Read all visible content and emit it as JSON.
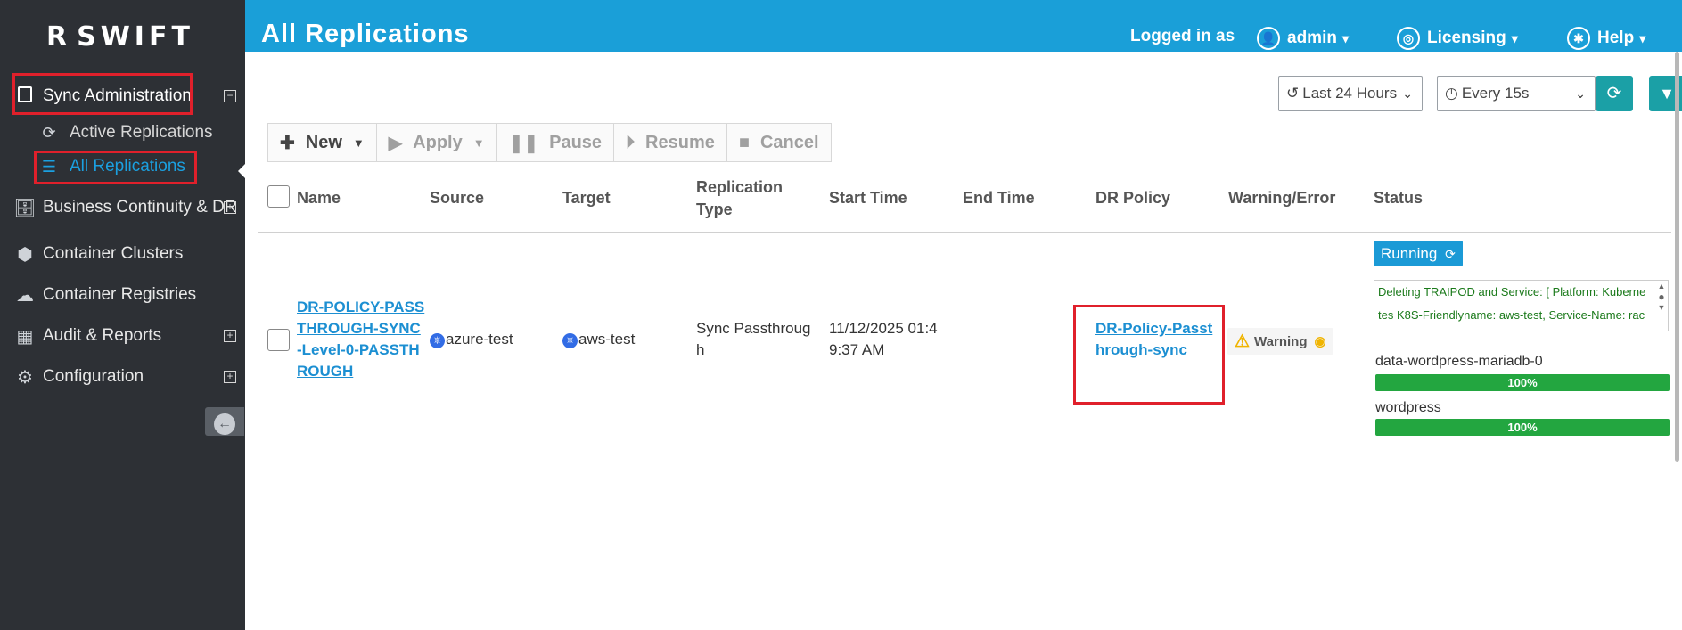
{
  "app": {
    "logo_r": "R",
    "logo_text": "SWIFT"
  },
  "sidebar": {
    "sync_admin": "Sync Administration",
    "active_replications": "Active Replications",
    "all_replications": "All Replications",
    "business_continuity": "Business Continuity & DR",
    "container_clusters": "Container Clusters",
    "container_registries": "Container Registries",
    "audit_reports": "Audit & Reports",
    "configuration": "Configuration"
  },
  "header": {
    "title": "All Replications",
    "logged_in_as": "Logged in as",
    "user": "admin",
    "licensing": "Licensing",
    "help": "Help"
  },
  "filters": {
    "time_range": "Last 24 Hours",
    "refresh_interval": "Every 15s"
  },
  "toolbar": {
    "new": "New",
    "apply": "Apply",
    "pause": "Pause",
    "resume": "Resume",
    "cancel": "Cancel"
  },
  "table": {
    "columns": {
      "name": "Name",
      "source": "Source",
      "target": "Target",
      "replication_type_1": "Replication",
      "replication_type_2": "Type",
      "start_time": "Start Time",
      "end_time": "End Time",
      "dr_policy": "DR Policy",
      "warning_error": "Warning/Error",
      "status": "Status"
    },
    "rows": [
      {
        "name_lines": [
          "DR-POLICY-PASS",
          "THROUGH-SYNC",
          "-Level-0-PASSTH",
          "ROUGH"
        ],
        "source": "azure-test",
        "target": "aws-test",
        "type_lines": [
          "Sync Passthroug",
          "h"
        ],
        "start_lines": [
          "11/12/2025 01:4",
          "9:37 AM"
        ],
        "end_time": "",
        "policy_lines": [
          "DR-Policy-Passt",
          "hrough-sync"
        ],
        "warning": "Warning",
        "status": "Running",
        "message_lines": [
          "Deleting TRAIPOD and Service: [ Platform: Kuberne",
          "tes K8S-Friendlyname: aws-test, Service-Name: rac"
        ],
        "pods": [
          {
            "name": "data-wordpress-mariadb-0",
            "progress": "100%"
          },
          {
            "name": "wordpress",
            "progress": "100%"
          }
        ]
      }
    ]
  },
  "colors": {
    "header": "#1a9fd8",
    "sidebar": "#2d3035",
    "highlight": "#e0202b",
    "progress": "#23a640",
    "link": "#1c8fd2"
  },
  "icons": {
    "logo": "swift-logo",
    "sync": "sync-icon",
    "list": "list-icon",
    "k8s": "kubernetes-icon"
  }
}
